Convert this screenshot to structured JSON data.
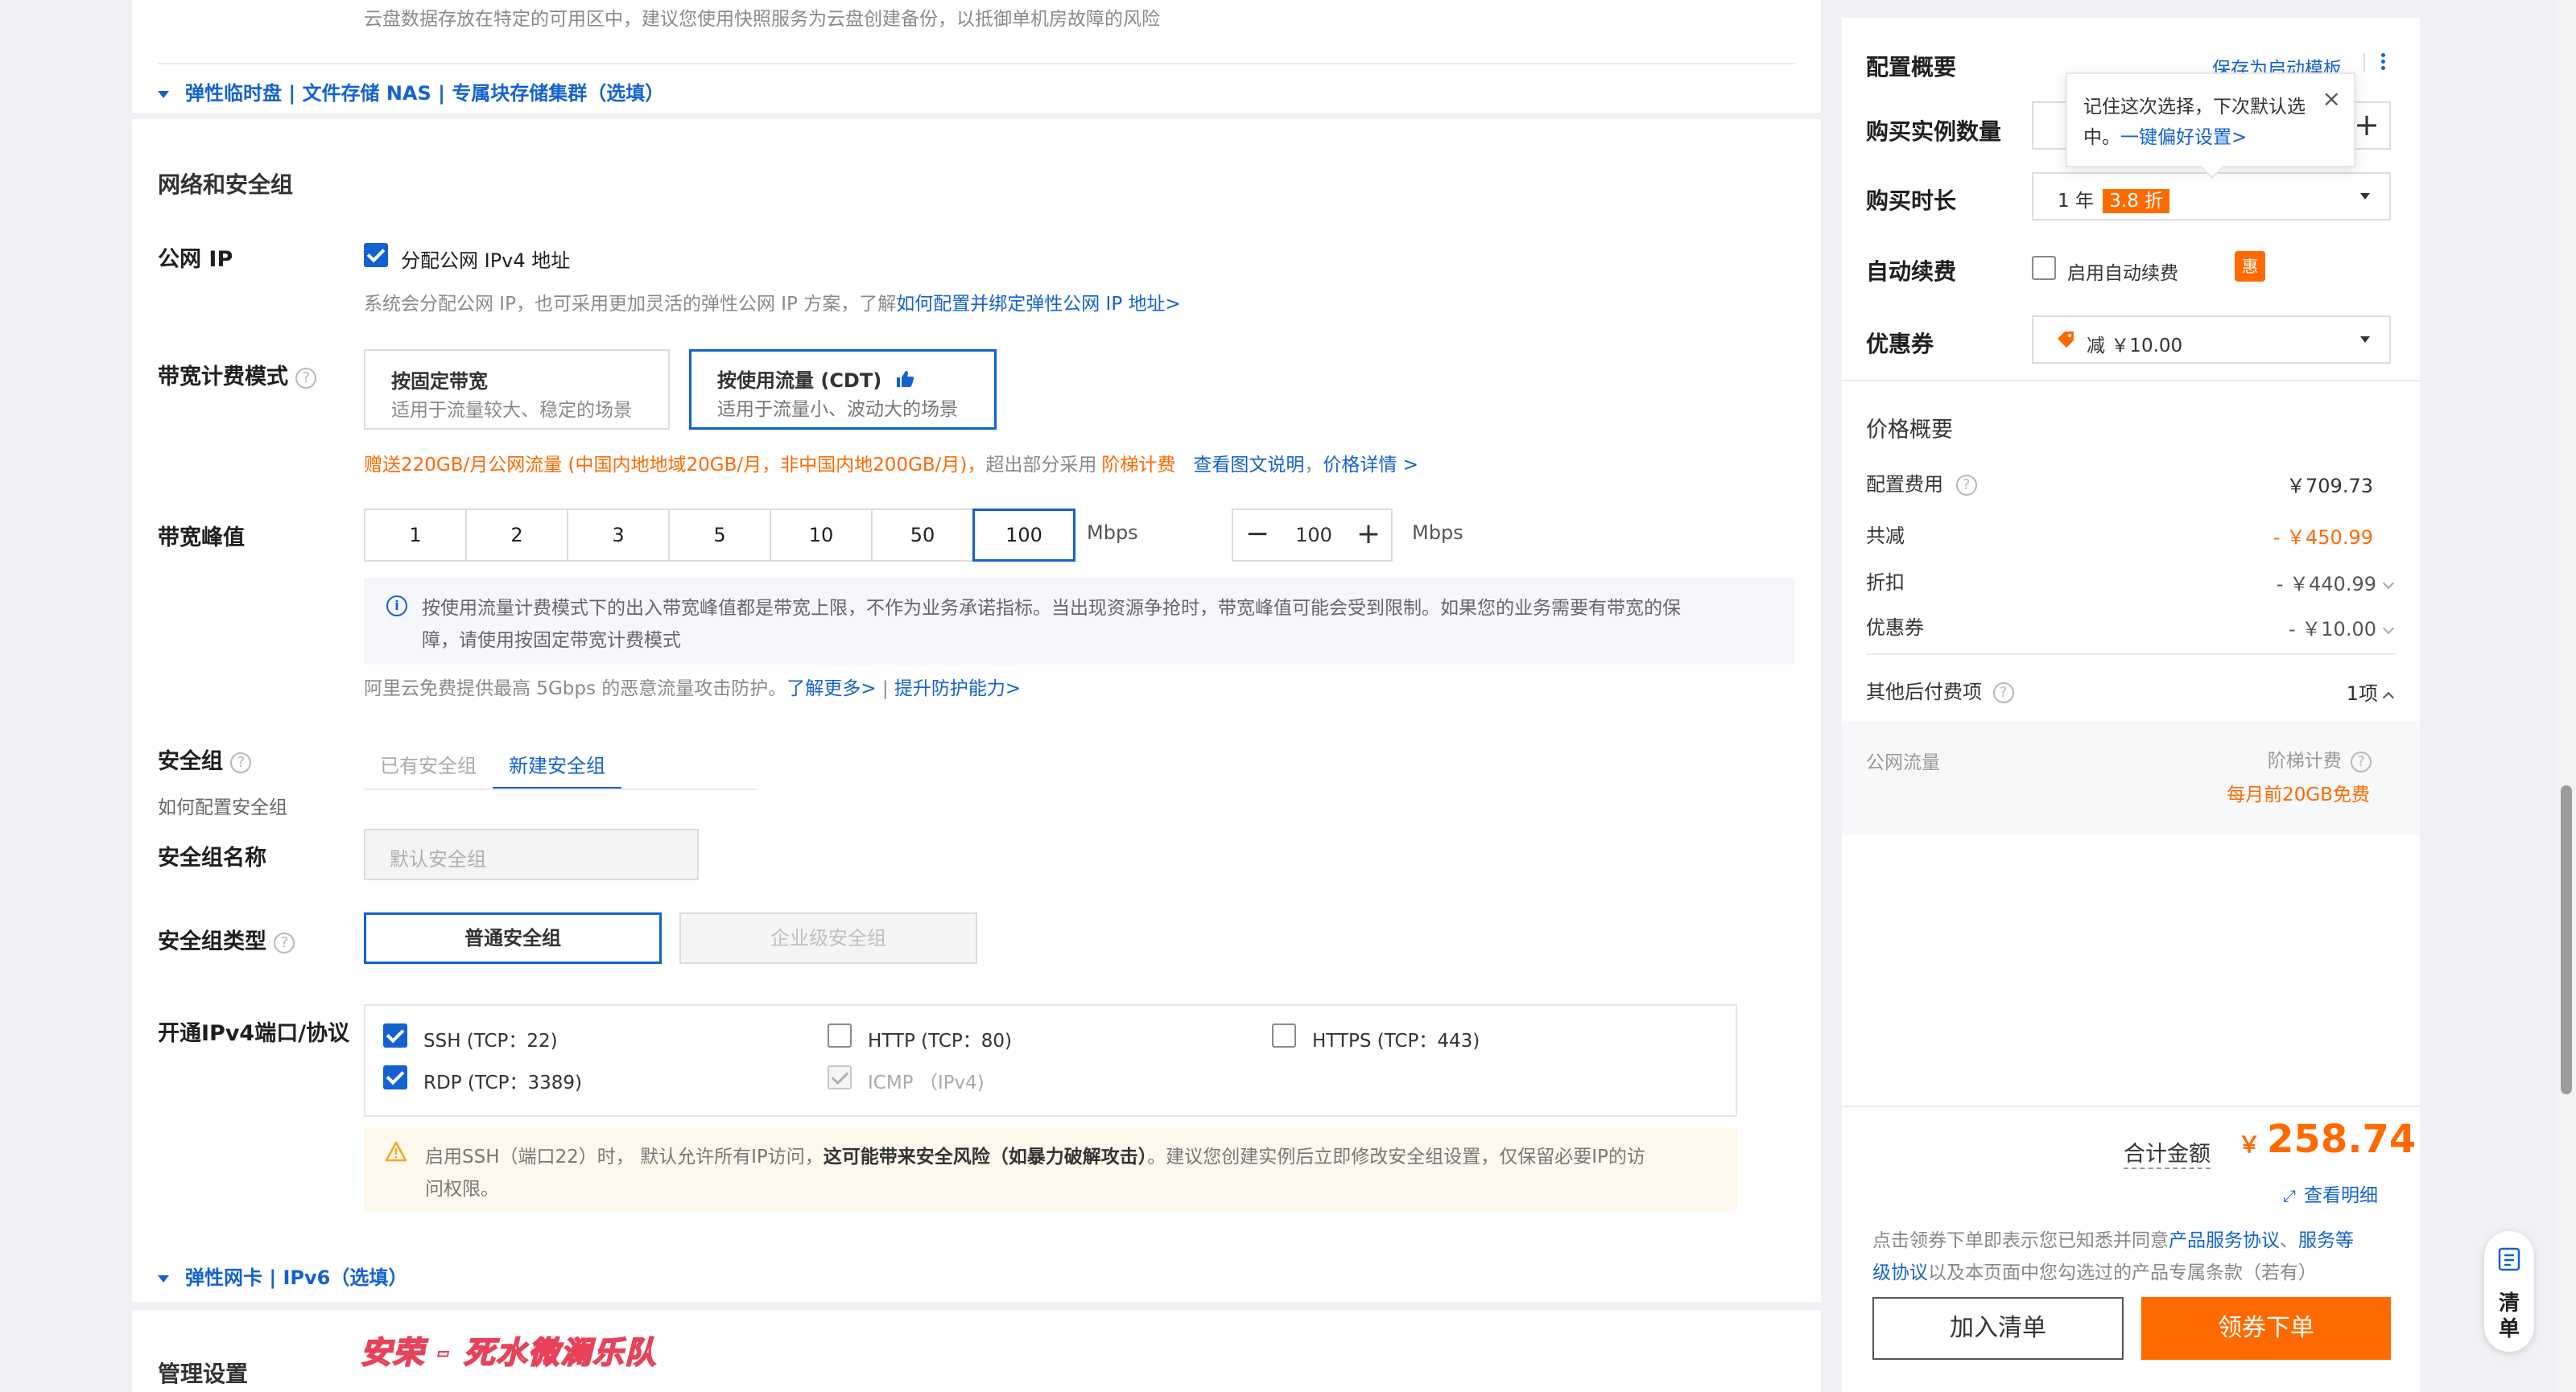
{
  "top_hint": "云盘数据存放在特定的可用区中，建议您使用快照服务为云盘创建备份，以抵御单机房故障的风险",
  "storage_expand": "弹性临时盘 | 文件存储 NAS | 专属块存储集群（选填）",
  "network": {
    "section_title": "网络和安全组",
    "public_ip": {
      "label": "公网 IP",
      "checkbox_label": "分配公网 IPv4 地址",
      "hint": "系统会分配公网 IP，也可采用更加灵活的弹性公网 IP 方案，了解",
      "hint_link": "如何配置并绑定弹性公网 IP 地址>"
    },
    "billing_mode": {
      "label": "带宽计费模式",
      "options": [
        {
          "title": "按固定带宽",
          "desc": "适用于流量较大、稳定的场景"
        },
        {
          "title": "按使用流量 (CDT)",
          "desc": "适用于流量小、波动大的场景"
        }
      ],
      "promo_orange": "赠送220GB/月公网流量 (中国内地地域20GB/月，非中国内地200GB/月)，",
      "promo_grey": "超出部分采用",
      "promo_tier": "阶梯计费",
      "promo_link1": "查看图文说明",
      "promo_link2": "价格详情 >"
    },
    "bandwidth": {
      "label": "带宽峰值",
      "options": [
        "1",
        "2",
        "3",
        "5",
        "10",
        "50",
        "100"
      ],
      "selected": "100",
      "unit": "Mbps",
      "stepper_value": "100",
      "stepper_unit": "Mbps",
      "info_line1": "按使用流量计费模式下的出入带宽峰值都是带宽上限，不作为业务承诺指标。当出现资源争抢时，带宽峰值可能会受到限制。如果您的业务需要有带宽的保",
      "info_line2": "障，请使用按固定带宽计费模式",
      "ddos_hint": "阿里云免费提供最高 5Gbps 的恶意流量攻击防护。",
      "ddos_link1": "了解更多>",
      "ddos_sep": "|",
      "ddos_link2": "提升防护能力>"
    },
    "security_group": {
      "label": "安全组",
      "sub_link": "如何配置安全组",
      "tabs": [
        "已有安全组",
        "新建安全组"
      ],
      "name_label": "安全组名称",
      "name_placeholder": "默认安全组",
      "type_label": "安全组类型",
      "types": [
        "普通安全组",
        "企业级安全组"
      ],
      "ports_label": "开通IPv4端口/协议",
      "ports": [
        {
          "label": "SSH (TCP：22)",
          "checked": true
        },
        {
          "label": "HTTP (TCP：80)",
          "checked": false
        },
        {
          "label": "HTTPS (TCP：443)",
          "checked": false
        },
        {
          "label": "RDP (TCP：3389)",
          "checked": true
        },
        {
          "label": "ICMP （IPv4)",
          "checked": true
        }
      ],
      "warn_a": "启用SSH（端口22）时， 默认允许所有IP访问，",
      "warn_b": "这可能带来安全风险（如暴力破解攻击）",
      "warn_c": "。建议您创建实例后立即修改安全组设置，仅保留必要IP的访",
      "warn_d": "问权限。"
    },
    "eni_expand": "弹性网卡 | IPv6（选填）"
  },
  "manage": {
    "title": "管理设置",
    "watermark": "安荣 - 死水微澜乐队"
  },
  "summary": {
    "title": "配置概要",
    "save_link": "保存为启动模板",
    "qty_label": "购买实例数量",
    "duration_label": "购买时长",
    "duration_value": "1 年",
    "duration_badge": "3.8 折",
    "auto_renew_label": "自动续费",
    "auto_renew_check": "启用自动续费",
    "auto_renew_badge": "惠",
    "coupon_label": "优惠券",
    "coupon_value": "减 ￥10.00",
    "tooltip_line1": "记住这次选择，下次默认选",
    "tooltip_line2": "中。",
    "tooltip_link": "一键偏好设置>"
  },
  "price": {
    "title": "价格概要",
    "config_fee_label": "配置费用",
    "config_fee": "￥709.73",
    "reduce_label": "共减",
    "reduce": "- ￥450.99",
    "discount_label": "折扣",
    "discount": "- ￥440.99",
    "coupon_label": "优惠券",
    "coupon": "- ￥10.00",
    "other_label": "其他后付费项",
    "other_count": "1项",
    "traffic_label": "公网流量",
    "traffic_type": "阶梯计费",
    "traffic_free": "每月前20GB免费"
  },
  "checkout": {
    "total_label": "合计金额",
    "currency": "￥",
    "total": "258.74",
    "detail_link": "查看明细",
    "agree_a": "点击领券下单即表示您已知悉并同意",
    "agree_link1": "产品服务协议",
    "agree_sep": "、",
    "agree_link2a": "服务等",
    "agree_link2b": "级协议",
    "agree_b": "以及本页面中您勾选过的产品专属条款（若有）",
    "cart_button": "加入清单",
    "order_button": "领券下单"
  },
  "float_cart": {
    "line1": "清",
    "line2": "单"
  },
  "colors": {
    "primary": "#1462d1",
    "accent": "#ff6a00",
    "warn_bg": "#fff8ec",
    "info_bg": "#f5f7fa"
  }
}
